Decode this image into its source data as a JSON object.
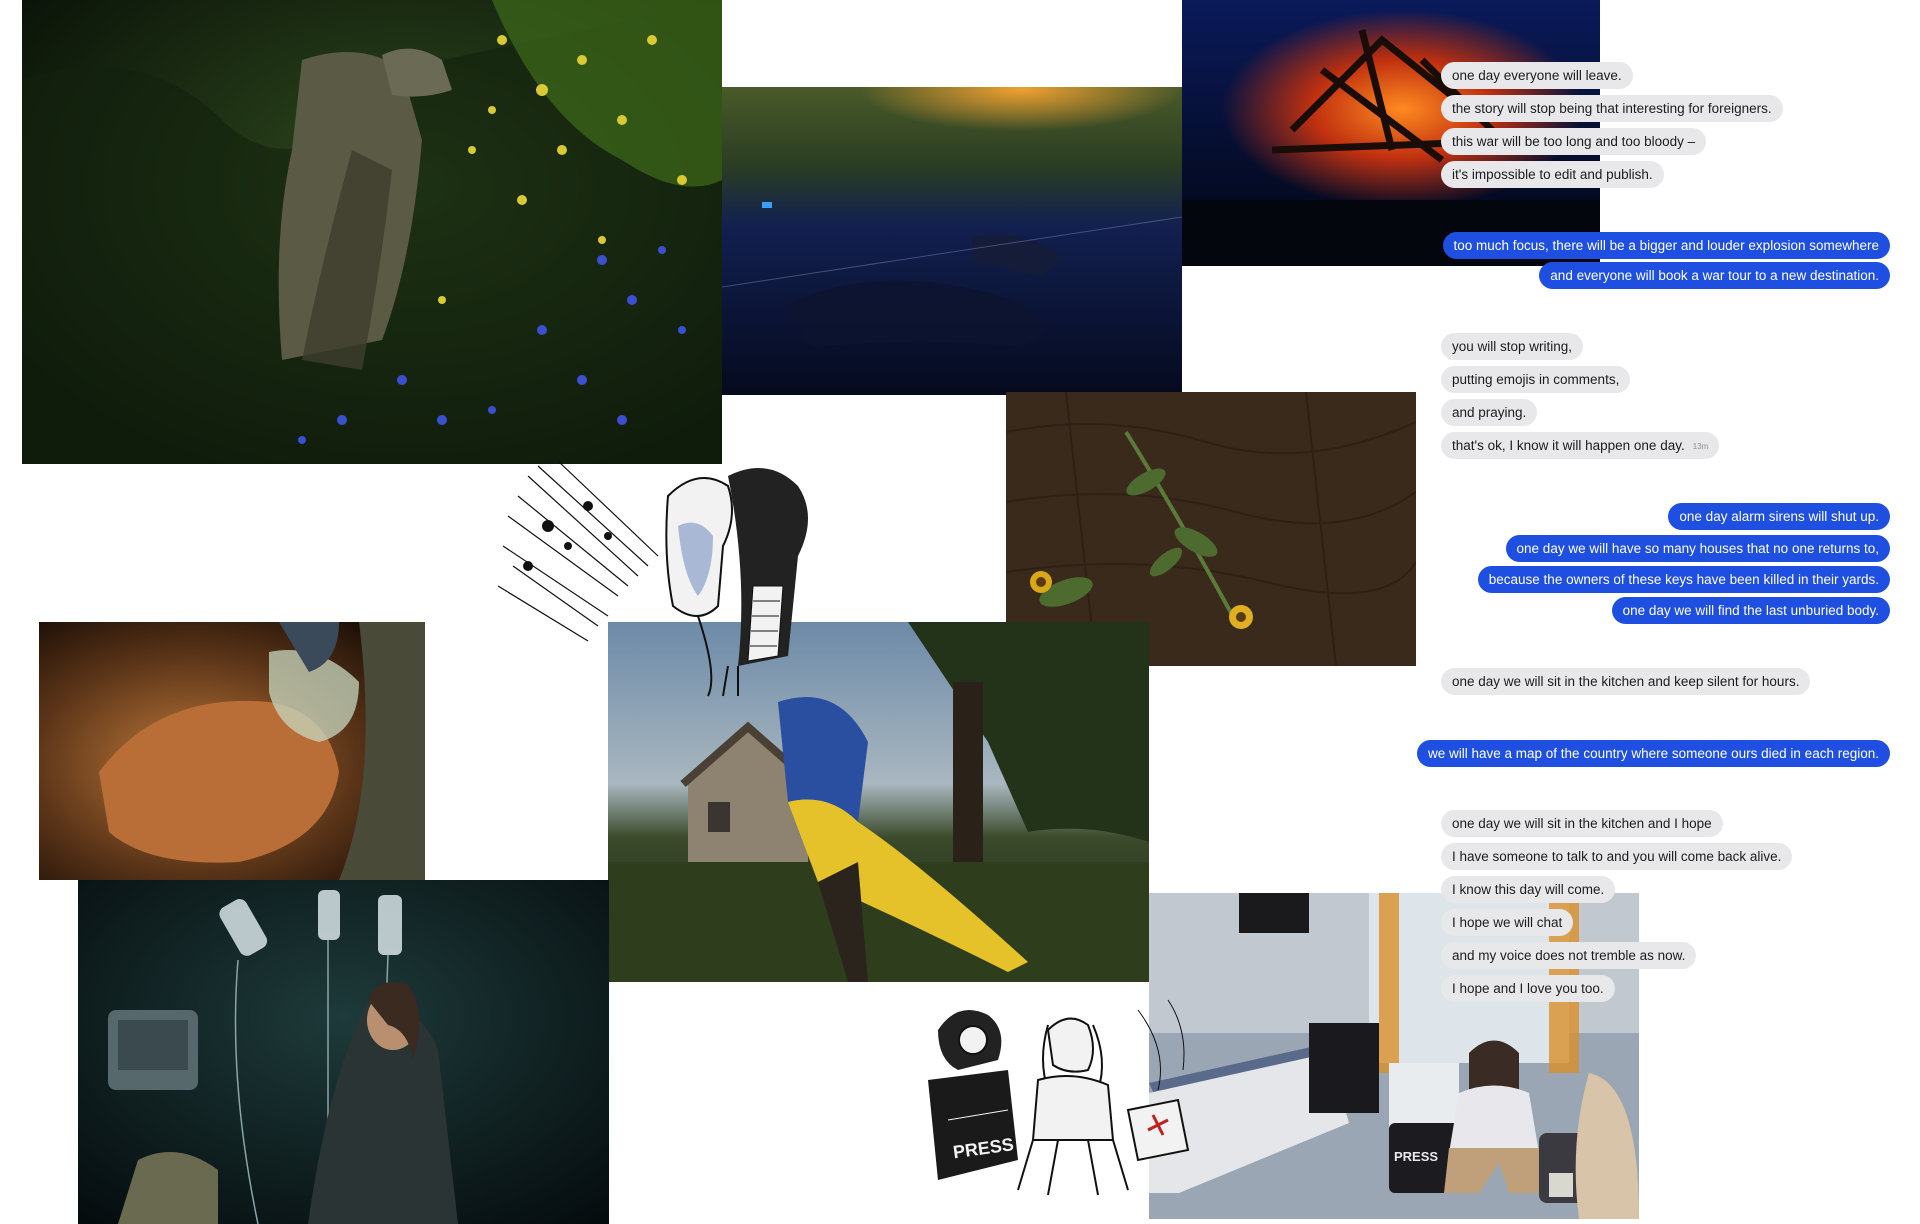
{
  "messages": [
    {
      "text": "one day everyone will leave.",
      "direction": "incoming"
    },
    {
      "text": "the story will stop being that interesting for foreigners.",
      "direction": "incoming"
    },
    {
      "text": "this war will be too long and too bloody –",
      "direction": "incoming"
    },
    {
      "text": "it's impossible to edit and publish.",
      "direction": "incoming"
    },
    {
      "text": "too much focus, there will be a bigger and louder explosion somewhere",
      "direction": "outgoing"
    },
    {
      "text": "and everyone will book a war tour to a new destination.",
      "direction": "outgoing"
    },
    {
      "text": "you will stop writing,",
      "direction": "incoming"
    },
    {
      "text": "putting emojis in comments,",
      "direction": "incoming"
    },
    {
      "text": "and praying.",
      "direction": "incoming"
    },
    {
      "text": "that's ok, I know it will happen one day.",
      "direction": "incoming",
      "timestamp": "13m"
    },
    {
      "text": "one day alarm sirens will shut up.",
      "direction": "outgoing"
    },
    {
      "text": "one day we will have so many houses that no one returns to,",
      "direction": "outgoing"
    },
    {
      "text": "because the owners of these keys have been killed in their yards.",
      "direction": "outgoing"
    },
    {
      "text": "one day we will find the last unburied body.",
      "direction": "outgoing"
    },
    {
      "text": "one day we will sit in the kitchen and keep silent for hours.",
      "direction": "incoming"
    },
    {
      "text": "we will have a map of the country where someone ours died in each region.",
      "direction": "outgoing"
    },
    {
      "text": "one day we will sit in the kitchen and I hope",
      "direction": "incoming"
    },
    {
      "text": "I have someone to talk to and you will come back alive.",
      "direction": "incoming"
    },
    {
      "text": "I know this day will come.",
      "direction": "incoming"
    },
    {
      "text": "I hope we will chat",
      "direction": "incoming"
    },
    {
      "text": "and my voice does not tremble as now.",
      "direction": "incoming"
    },
    {
      "text": "I hope and I love you too.",
      "direction": "incoming"
    }
  ],
  "illustration_text": {
    "press_bag": "PRESS",
    "press_bag_photo": "PRESS"
  },
  "colors": {
    "incoming_bubble": "#e8e8ea",
    "outgoing_bubble": "#1e4fe0",
    "flag_blue": "#2b4fa0",
    "flag_yellow": "#e6c22a"
  }
}
